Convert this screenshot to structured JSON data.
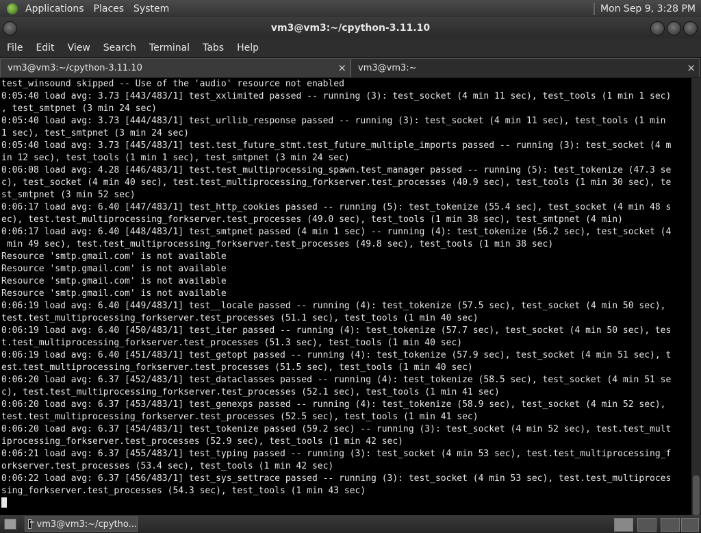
{
  "top_panel": {
    "menus": [
      "Applications",
      "Places",
      "System"
    ],
    "clock": "Mon Sep  9,  3:28 PM"
  },
  "window": {
    "title": "vm3@vm3:~/cpython-3.11.10"
  },
  "menubar": {
    "items": [
      "File",
      "Edit",
      "View",
      "Search",
      "Terminal",
      "Tabs",
      "Help"
    ]
  },
  "tabs": [
    {
      "label": "vm3@vm3:~/cpython-3.11.10",
      "close": "×"
    },
    {
      "label": "vm3@vm3:~",
      "close": "×"
    }
  ],
  "terminal": {
    "lines": [
      "test_winsound skipped -- Use of the 'audio' resource not enabled",
      "0:05:40 load avg: 3.73 [443/483/1] test_xxlimited passed -- running (3): test_socket (4 min 11 sec), test_tools (1 min 1 sec)",
      ", test_smtpnet (3 min 24 sec)",
      "0:05:40 load avg: 3.73 [444/483/1] test_urllib_response passed -- running (3): test_socket (4 min 11 sec), test_tools (1 min",
      "1 sec), test_smtpnet (3 min 24 sec)",
      "0:05:40 load avg: 3.73 [445/483/1] test.test_future_stmt.test_future_multiple_imports passed -- running (3): test_socket (4 m",
      "in 12 sec), test_tools (1 min 1 sec), test_smtpnet (3 min 24 sec)",
      "0:06:08 load avg: 4.28 [446/483/1] test.test_multiprocessing_spawn.test_manager passed -- running (5): test_tokenize (47.3 se",
      "c), test_socket (4 min 40 sec), test.test_multiprocessing_forkserver.test_processes (40.9 sec), test_tools (1 min 30 sec), te",
      "st_smtpnet (3 min 52 sec)",
      "0:06:17 load avg: 6.40 [447/483/1] test_http_cookies passed -- running (5): test_tokenize (55.4 sec), test_socket (4 min 48 s",
      "ec), test.test_multiprocessing_forkserver.test_processes (49.0 sec), test_tools (1 min 38 sec), test_smtpnet (4 min)",
      "0:06:17 load avg: 6.40 [448/483/1] test_smtpnet passed (4 min 1 sec) -- running (4): test_tokenize (56.2 sec), test_socket (4",
      " min 49 sec), test.test_multiprocessing_forkserver.test_processes (49.8 sec), test_tools (1 min 38 sec)",
      "Resource 'smtp.gmail.com' is not available",
      "Resource 'smtp.gmail.com' is not available",
      "Resource 'smtp.gmail.com' is not available",
      "Resource 'smtp.gmail.com' is not available",
      "0:06:19 load avg: 6.40 [449/483/1] test__locale passed -- running (4): test_tokenize (57.5 sec), test_socket (4 min 50 sec),",
      "test.test_multiprocessing_forkserver.test_processes (51.1 sec), test_tools (1 min 40 sec)",
      "0:06:19 load avg: 6.40 [450/483/1] test_iter passed -- running (4): test_tokenize (57.7 sec), test_socket (4 min 50 sec), tes",
      "t.test_multiprocessing_forkserver.test_processes (51.3 sec), test_tools (1 min 40 sec)",
      "0:06:19 load avg: 6.40 [451/483/1] test_getopt passed -- running (4): test_tokenize (57.9 sec), test_socket (4 min 51 sec), t",
      "est.test_multiprocessing_forkserver.test_processes (51.5 sec), test_tools (1 min 40 sec)",
      "0:06:20 load avg: 6.37 [452/483/1] test_dataclasses passed -- running (4): test_tokenize (58.5 sec), test_socket (4 min 51 se",
      "c), test.test_multiprocessing_forkserver.test_processes (52.1 sec), test_tools (1 min 41 sec)",
      "0:06:20 load avg: 6.37 [453/483/1] test_genexps passed -- running (4): test_tokenize (58.9 sec), test_socket (4 min 52 sec),",
      "test.test_multiprocessing_forkserver.test_processes (52.5 sec), test_tools (1 min 41 sec)",
      "0:06:20 load avg: 6.37 [454/483/1] test_tokenize passed (59.2 sec) -- running (3): test_socket (4 min 52 sec), test.test_mult",
      "iprocessing_forkserver.test_processes (52.9 sec), test_tools (1 min 42 sec)",
      "0:06:21 load avg: 6.37 [455/483/1] test_typing passed -- running (3): test_socket (4 min 53 sec), test.test_multiprocessing_f",
      "orkserver.test_processes (53.4 sec), test_tools (1 min 42 sec)",
      "0:06:22 load avg: 6.37 [456/483/1] test_sys_settrace passed -- running (3): test_socket (4 min 53 sec), test.test_multiproces",
      "sing_forkserver.test_processes (54.3 sec), test_tools (1 min 43 sec)"
    ]
  },
  "taskbar": {
    "task_label": "vm3@vm3:~/cpytho..."
  }
}
